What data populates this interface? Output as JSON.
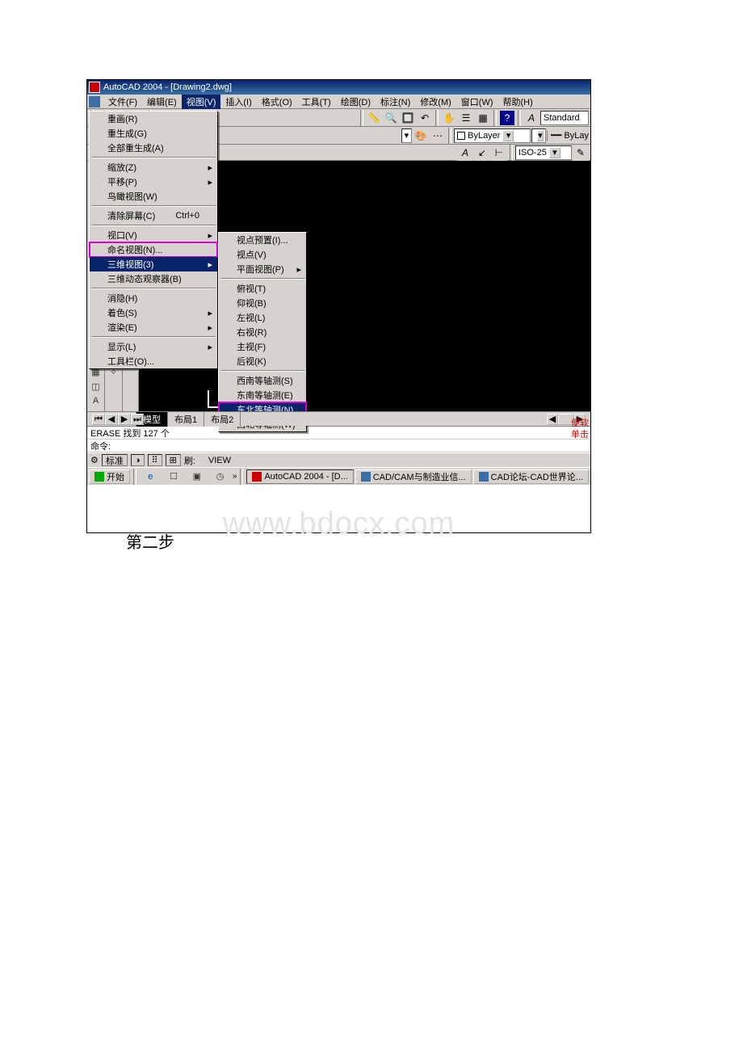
{
  "title": "AutoCAD 2004 - [Drawing2.dwg]",
  "menubar": [
    "文件(F)",
    "编辑(E)",
    "视图(V)",
    "插入(I)",
    "格式(O)",
    "工具(T)",
    "绘图(D)",
    "标注(N)",
    "修改(M)",
    "窗口(W)",
    "帮助(H)"
  ],
  "open_menu_index": 2,
  "view_menu": {
    "items": [
      {
        "label": "重画(R)"
      },
      {
        "label": "重生成(G)"
      },
      {
        "label": "全部重生成(A)"
      },
      {
        "sep": true
      },
      {
        "label": "缩放(Z)",
        "sub": true
      },
      {
        "label": "平移(P)",
        "sub": true
      },
      {
        "label": "鸟瞰视图(W)"
      },
      {
        "sep": true
      },
      {
        "label": "清除屏幕(C)",
        "shortcut": "Ctrl+0"
      },
      {
        "sep": true
      },
      {
        "label": "视口(V)",
        "sub": true
      },
      {
        "label": "命名视图(N)...",
        "hi": true
      },
      {
        "label": "三维视图(3)",
        "sub": true,
        "sel": true
      },
      {
        "label": "三维动态观察器(B)"
      },
      {
        "sep": true
      },
      {
        "label": "消隐(H)"
      },
      {
        "label": "着色(S)",
        "sub": true
      },
      {
        "label": "渲染(E)",
        "sub": true
      },
      {
        "sep": true
      },
      {
        "label": "显示(L)",
        "sub": true
      },
      {
        "label": "工具栏(O)..."
      }
    ]
  },
  "submenu": {
    "items": [
      {
        "label": "视点预置(I)..."
      },
      {
        "label": "视点(V)"
      },
      {
        "label": "平面视图(P)",
        "sub": true
      },
      {
        "sep": true
      },
      {
        "label": "俯视(T)"
      },
      {
        "label": "仰视(B)"
      },
      {
        "label": "左视(L)"
      },
      {
        "label": "右视(R)"
      },
      {
        "label": "主视(F)"
      },
      {
        "label": "后视(K)"
      },
      {
        "sep": true
      },
      {
        "label": "西南等轴测(S)"
      },
      {
        "label": "东南等轴测(E)"
      },
      {
        "label": "东北等轴测(N)",
        "sel": true,
        "hi": true
      },
      {
        "label": "西北等轴测(W)"
      }
    ]
  },
  "toolbar2_text": "Standard",
  "bylayer": "ByLayer",
  "bylay2": "ByLay",
  "dim_style": "ISO-25",
  "tabs": {
    "active": "模型",
    "others": [
      "布局1",
      "布局2"
    ]
  },
  "cmd": {
    "line1": "ERASE 找到 127 个",
    "line2": "命令:"
  },
  "status": {
    "a": "标准",
    "b": "刷:",
    "c": "VIEW"
  },
  "taskbar": {
    "start": "开始",
    "btns": [
      "AutoCAD 2004 - [D...",
      "CAD/CAM与制造业信...",
      "CAD论坛-CAD世界论..."
    ]
  },
  "side": {
    "a": "便软",
    "b": "单击"
  },
  "watermark": "www.bdocx.com",
  "caption": "第二步"
}
